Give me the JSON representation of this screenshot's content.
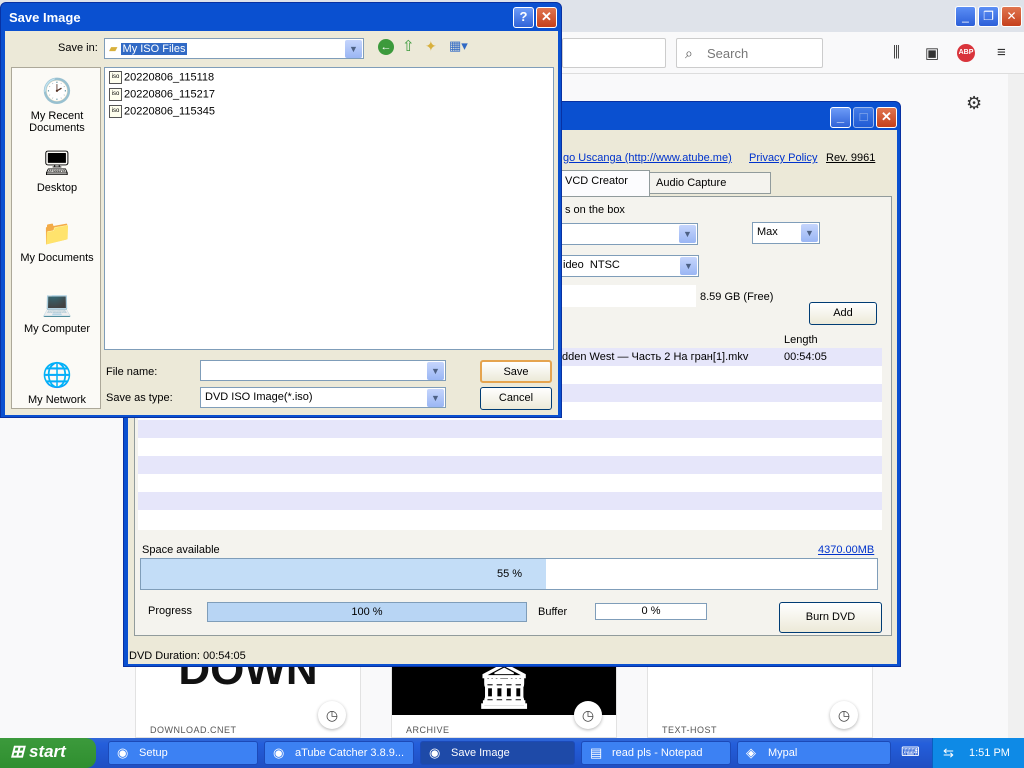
{
  "firefox": {
    "search_placeholder": "Search",
    "tiles": [
      {
        "caption": "DOWNLOAD.CNET",
        "image_text": "DOWN"
      },
      {
        "caption": "ARCHIVE",
        "image_text": "🏛"
      },
      {
        "caption": "TEXT-HOST",
        "image_text": ""
      }
    ]
  },
  "atube": {
    "links": [
      "go Uscanga (http://www.atube.me)",
      "Privacy Policy",
      "Rev. 9961"
    ],
    "tabs": [
      "VCD Creator",
      "Audio Capture"
    ],
    "box_label": "s on the box",
    "quality_value": "Max",
    "video_label": "ideo",
    "video_format": "NTSC",
    "free_space": "8.59 GB (Free)",
    "add_label": "Add",
    "list_header_length": "Length",
    "list_rows": [
      {
        "name": "dden West — Часть 2 На гран[1].mkv",
        "length": "00:54:05"
      }
    ],
    "space_available_label": "Space available",
    "space_value": "4370.00MB",
    "space_percent": "55 %",
    "space_fraction": 0.55,
    "progress_label": "Progress",
    "progress_value": "100 %",
    "buffer_label": "Buffer",
    "buffer_value": "0 %",
    "burn_label": "Burn DVD",
    "status": "DVD Duration: 00:54:05"
  },
  "dialog": {
    "title": "Save Image",
    "save_in_label": "Save in:",
    "save_in_value": "My ISO Files",
    "places": [
      "My Recent Documents",
      "Desktop",
      "My Documents",
      "My Computer",
      "My Network"
    ],
    "files": [
      "20220806_115118",
      "20220806_115217",
      "20220806_115345"
    ],
    "file_name_label": "File name:",
    "file_name_value": "",
    "save_as_type_label": "Save as type:",
    "save_as_type_value": "DVD ISO Image(*.iso)",
    "save_label": "Save",
    "cancel_label": "Cancel",
    "help_label": "?",
    "close_label": "✕"
  },
  "taskbar": {
    "start_label": "start",
    "tasks": [
      "Setup",
      "aTube Catcher 3.8.9...",
      "Save Image",
      "read pls - Notepad",
      "Mypal"
    ],
    "clock": "1:51 PM"
  }
}
